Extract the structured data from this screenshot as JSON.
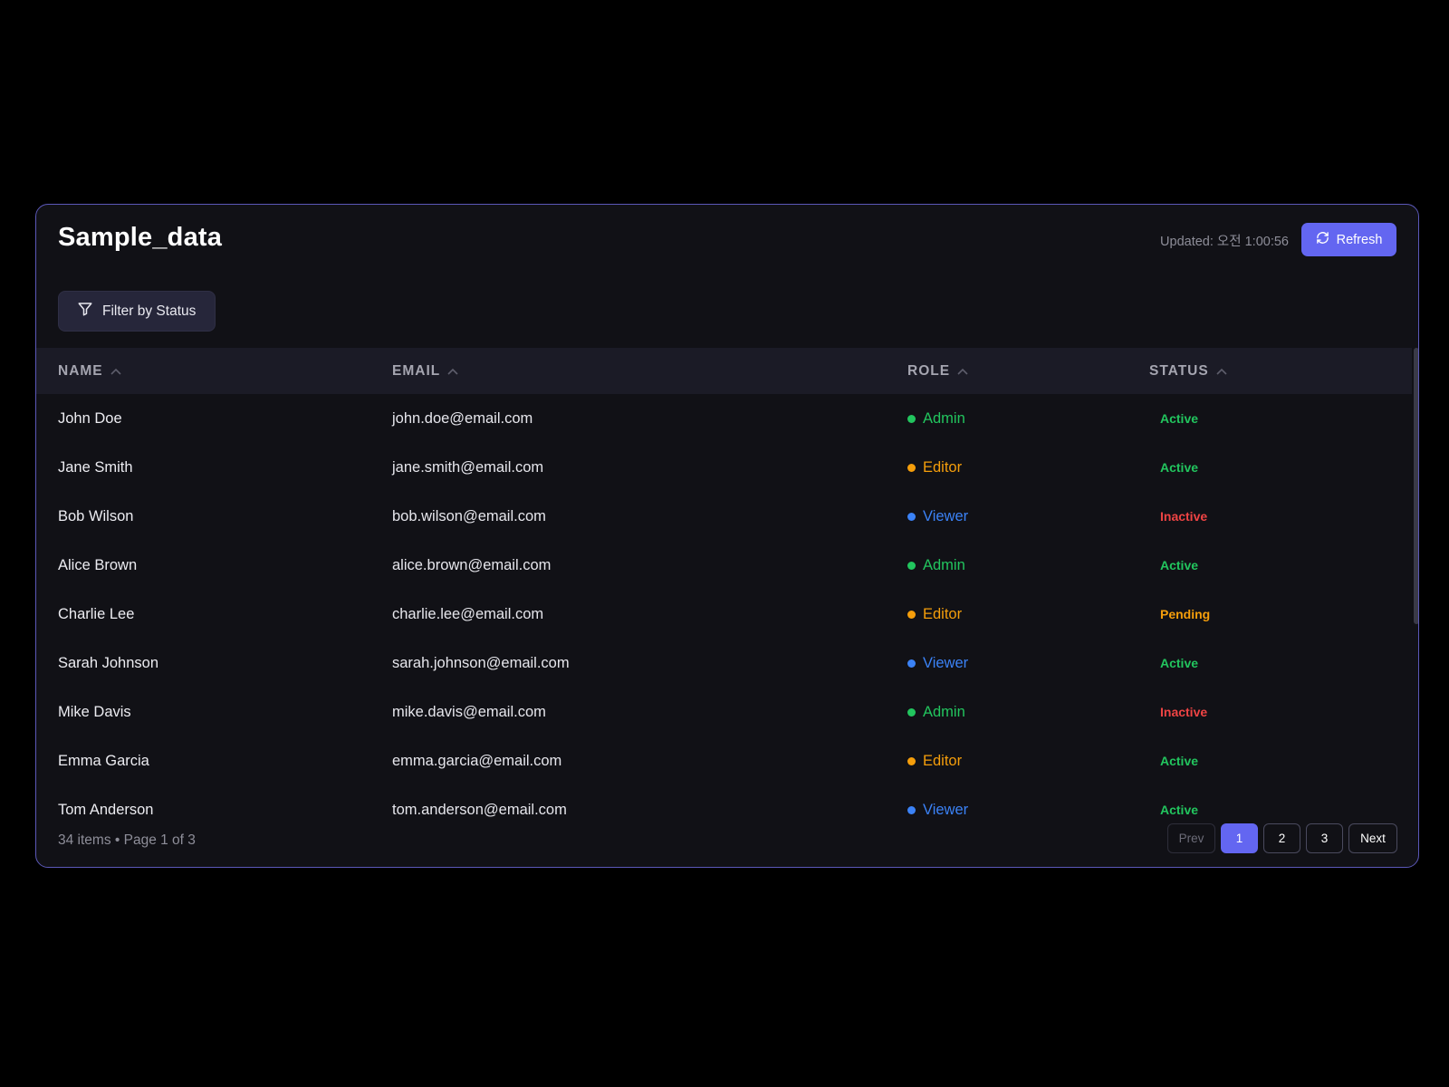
{
  "header": {
    "title": "Sample_data",
    "updated": "Updated: 오전 1:00:56",
    "refresh_label": "Refresh"
  },
  "filter": {
    "label": "Filter by Status"
  },
  "table": {
    "columns": [
      {
        "label": "NAME",
        "sort": "asc"
      },
      {
        "label": "EMAIL",
        "sort": "asc"
      },
      {
        "label": "ROLE",
        "sort": "asc"
      },
      {
        "label": "STATUS",
        "sort": "asc"
      }
    ],
    "rows": [
      {
        "name": "John Doe",
        "email": "john.doe@email.com",
        "role": "Admin",
        "status": "Active"
      },
      {
        "name": "Jane Smith",
        "email": "jane.smith@email.com",
        "role": "Editor",
        "status": "Active"
      },
      {
        "name": "Bob Wilson",
        "email": "bob.wilson@email.com",
        "role": "Viewer",
        "status": "Inactive"
      },
      {
        "name": "Alice Brown",
        "email": "alice.brown@email.com",
        "role": "Admin",
        "status": "Active"
      },
      {
        "name": "Charlie Lee",
        "email": "charlie.lee@email.com",
        "role": "Editor",
        "status": "Pending"
      },
      {
        "name": "Sarah Johnson",
        "email": "sarah.johnson@email.com",
        "role": "Viewer",
        "status": "Active"
      },
      {
        "name": "Mike Davis",
        "email": "mike.davis@email.com",
        "role": "Admin",
        "status": "Inactive"
      },
      {
        "name": "Emma Garcia",
        "email": "emma.garcia@email.com",
        "role": "Editor",
        "status": "Active"
      },
      {
        "name": "Tom Anderson",
        "email": "tom.anderson@email.com",
        "role": "Viewer",
        "status": "Active"
      }
    ]
  },
  "role_colors": {
    "Admin": "#22c55e",
    "Editor": "#f59e0b",
    "Viewer": "#3b82f6"
  },
  "status_colors": {
    "Active": "#22c55e",
    "Inactive": "#ef4444",
    "Pending": "#f59e0b"
  },
  "footer": {
    "summary": "34 items • Page 1 of 3",
    "prev_label": "Prev",
    "pages": [
      "1",
      "2",
      "3"
    ],
    "current_page": "1",
    "next_label": "Next"
  },
  "colors": {
    "accent": "#6366f1",
    "panel_border": "#5b58b8",
    "panel_bg": "#111116"
  },
  "icons": {
    "refresh": "refresh-icon",
    "filter": "filter-icon",
    "sort": "chevron-up-icon"
  }
}
